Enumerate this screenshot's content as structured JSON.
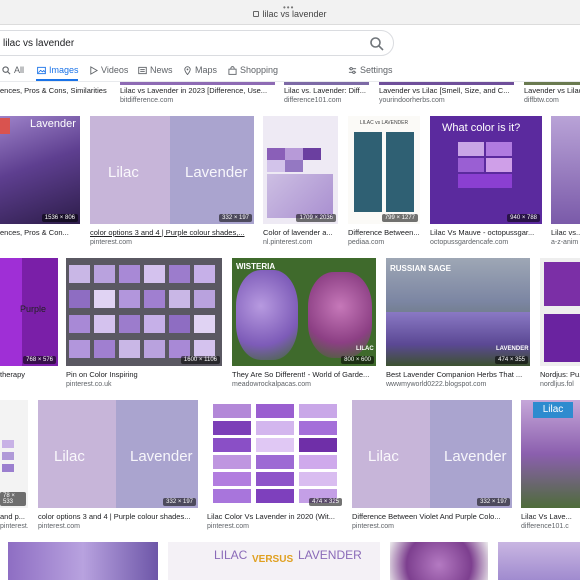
{
  "browser": {
    "url": "lilac vs lavender",
    "dots": "•••"
  },
  "search": {
    "query": "lilac vs lavender"
  },
  "tabs": [
    {
      "label": "All"
    },
    {
      "label": "Images"
    },
    {
      "label": "Videos"
    },
    {
      "label": "News"
    },
    {
      "label": "Maps"
    },
    {
      "label": "Shopping"
    }
  ],
  "settings_label": "Settings",
  "top_row": [
    {
      "caption": "ences, Pros & Cons, Similarities",
      "source": ""
    },
    {
      "caption": "Lilac vs Lavender in 2023 [Difference, Use...",
      "source": "bitdifference.com"
    },
    {
      "caption": "Lilac vs. Lavender: Diff...",
      "source": "difference101.com"
    },
    {
      "caption": "Lavender vs Lilac [Smell, Size, and C...",
      "source": "yourindoorherbs.com"
    },
    {
      "caption": "Lavender vs Lilac",
      "source": "diffbtw.com"
    }
  ],
  "row1": [
    {
      "caption": "ences, Pros & Con...",
      "source": "",
      "dims": "1536 × 806",
      "overlay": "Lavender"
    },
    {
      "caption": "color options 3 and 4 | Purple colour shades,...",
      "source": "pinterest.com",
      "dims": "332 × 197",
      "left": "Lilac",
      "right": "Lavender"
    },
    {
      "caption": "Color of lavender a...",
      "source": "nl.pinterest.com",
      "dims": "1709 × 2036"
    },
    {
      "caption": "Difference Between...",
      "source": "pediaa.com",
      "dims": "799 × 1277",
      "title": "LILAC vs LAVENDER"
    },
    {
      "caption": "Lilac Vs Mauve - octopussgar...",
      "source": "octopussgardencafe.com",
      "dims": "940 × 788",
      "q": "What color is it?"
    },
    {
      "caption": "Lilac vs...",
      "source": "a-z-anim"
    }
  ],
  "row2": [
    {
      "caption": "therapy",
      "source": "",
      "dims": "768 × 576",
      "label": "Purple"
    },
    {
      "caption": "Pin on Color Inspiring",
      "source": "pinterest.co.uk",
      "dims": "1600 × 1106"
    },
    {
      "caption": "They Are So Different! - World of Garde...",
      "source": "meadowrockalpacas.com",
      "dims": "800 × 600",
      "left": "WISTERIA",
      "right": "LILAC"
    },
    {
      "caption": "Best Lavender Companion Herbs That ...",
      "source": "wwwmyworld0222.blogspot.com",
      "dims": "474 × 355",
      "top": "RUSSIAN SAGE",
      "bottom": "LAVENDER"
    },
    {
      "caption": "Nordjus: Pu...",
      "source": "nordljus.fol"
    }
  ],
  "row3": [
    {
      "caption": "and p...",
      "source": "pinterest.com",
      "dims": "78 × 533"
    },
    {
      "caption": "color options 3 and 4 | Purple colour shades...",
      "source": "pinterest.com",
      "dims": "332 × 197",
      "left": "Lilac",
      "right": "Lavender"
    },
    {
      "caption": "Lilac Color Vs Lavender in 2020 (Wit...",
      "source": "pinterest.com",
      "dims": "474 × 325"
    },
    {
      "caption": "Difference Between Violet And Purple Colo...",
      "source": "pinterest.com",
      "dims": "332 × 197",
      "left": "Lilac",
      "right": "Lavender"
    },
    {
      "caption": "Lilac Vs Lave...",
      "source": "difference101.c",
      "title": "Lilac"
    }
  ],
  "row4": {
    "title_left": "LILAC",
    "title_mid": "VERSUS",
    "title_right": "LAVENDER"
  },
  "colors": {
    "accent": "#1a73e8",
    "lilac": "#c8a2c8",
    "lavender": "#a8a3cf",
    "purple": "#8a2be2"
  }
}
